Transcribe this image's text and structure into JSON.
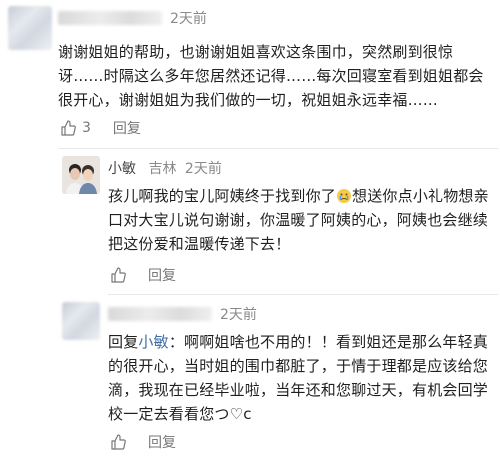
{
  "comments": [
    {
      "time": "2天前",
      "text": "谢谢姐姐的帮助，也谢谢姐姐喜欢这条围巾，突然刷到很惊讶……时隔这么多年您居然还记得……每次回寝室看到姐姐都会很开心，谢谢姐姐为我们做的一切，祝姐姐永远幸福……",
      "likes": "3",
      "reply_label": "回复"
    },
    {
      "name": "小敏",
      "location": "吉林",
      "time": "2天前",
      "text_before_emoji": "孩儿啊我的宝儿阿姨终于找到你了",
      "emoji": "crying-face-emoji",
      "text_after_emoji": "想送你点小礼物想亲口对大宝儿说句谢谢，你温暖了阿姨的心，阿姨也会继续把这份爱和温暖传递下去！",
      "likes": "",
      "reply_label": "回复"
    },
    {
      "time": "2天前",
      "reply_prefix": "回复",
      "reply_to": "小敏",
      "text": "：啊啊姐啥也不用的！！看到姐还是那么年轻真的很开心，当时姐的围巾都脏了，于情于理都是应该给您滴，我现在已经毕业啦，当年还和您聊过天，有机会回学校一定去看看您つ♡c",
      "likes": "",
      "reply_label": "回复"
    }
  ],
  "colors": {
    "link": "#3d6ea8",
    "meta": "#8a8a8a",
    "emoji": "#f7c948"
  }
}
